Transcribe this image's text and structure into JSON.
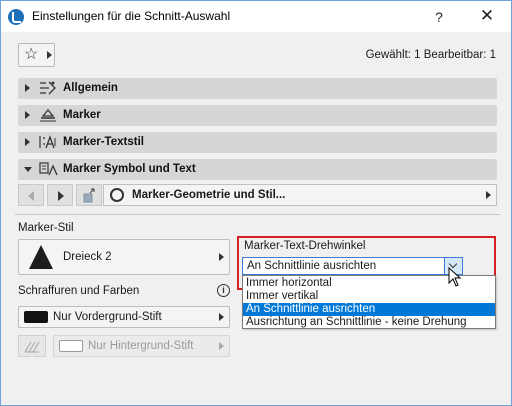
{
  "window": {
    "title": "Einstellungen für die Schnitt-Auswahl",
    "help_label": "?",
    "close_label": "✕"
  },
  "toolbar": {
    "favorites_icon": "star-icon",
    "selection_info": "Gewählt: 1 Bearbeitbar: 1"
  },
  "sections": [
    {
      "label": "Allgemein",
      "icon": "general-settings-icon",
      "expanded": false
    },
    {
      "label": "Marker",
      "icon": "marker-icon",
      "expanded": false
    },
    {
      "label": "Marker-Textstil",
      "icon": "text-style-icon",
      "expanded": false
    },
    {
      "label": "Marker Symbol und Text",
      "icon": "symbol-text-icon",
      "expanded": true
    }
  ],
  "subpanel": {
    "label": "Marker-Geometrie und Stil..."
  },
  "marker_style": {
    "label": "Marker-Stil",
    "value": "Dreieck 2"
  },
  "hatching": {
    "label": "Schraffuren und Farben",
    "info": "i",
    "foreground_pen": "Nur Vordergrund-Stift",
    "background_pen": "Nur Hintergrund-Stift"
  },
  "rotation": {
    "label": "Marker-Text-Drehwinkel",
    "selected": "An Schnittlinie ausrichten",
    "options": [
      "Immer horizontal",
      "Immer vertikal",
      "An Schnittlinie ausrichten",
      "Ausrichtung an Schnittlinie - keine Drehung"
    ],
    "highlighted_index": 2
  },
  "colors": {
    "accent": "#0078d7",
    "highlight_box": "#d42020",
    "section_bg": "#d6d6d6"
  }
}
